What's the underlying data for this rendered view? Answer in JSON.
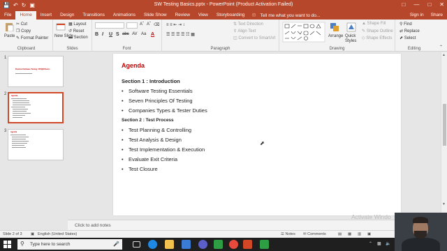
{
  "window": {
    "title": "SW Testing Basics.pptx - PowerPoint (Product Activation Failed)",
    "accent": "#b7472a"
  },
  "ribbon_tabs": [
    "File",
    "Home",
    "Insert",
    "Design",
    "Transitions",
    "Animations",
    "Slide Show",
    "Review",
    "View",
    "Storyboarding"
  ],
  "active_tab": "Home",
  "tell_me": "Tell me what you want to do...",
  "account": {
    "sign_in": "Sign in",
    "share": "Share"
  },
  "clipboard": {
    "paste": "Paste",
    "cut": "Cut",
    "copy": "Copy",
    "format_painter": "Format Painter",
    "label": "Clipboard"
  },
  "slides_group": {
    "new_slide": "New Slide",
    "layout": "Layout",
    "reset": "Reset",
    "section": "Section",
    "label": "Slides"
  },
  "font_group": {
    "label": "Font",
    "buttons": [
      "B",
      "I",
      "U",
      "S",
      "abc",
      "AV",
      "Aa",
      "A"
    ]
  },
  "paragraph_group": {
    "text_direction": "Text Direction",
    "align_text": "Align Text",
    "convert_smartart": "Convert to SmartArt",
    "label": "Paragraph"
  },
  "drawing_group": {
    "arrange": "Arrange",
    "quick_styles": "Quick Styles",
    "shape_fill": "Shape Fill",
    "shape_outline": "Shape Outline",
    "shape_effects": "Shape Effects",
    "label": "Drawing"
  },
  "editing_group": {
    "find": "Find",
    "replace": "Replace",
    "select": "Select",
    "label": "Editing"
  },
  "thumbnails": [
    {
      "number": "1",
      "title": "Practical Software Testing / ISTQB Basics"
    },
    {
      "number": "2",
      "title": "Agenda"
    },
    {
      "number": "3",
      "title": "Agenda"
    }
  ],
  "slide": {
    "heading": "Agenda",
    "section1": "Section 1 : Introduction",
    "section1_items": [
      "Software Testing Essentials",
      "Seven Principles Of Testing",
      "Companies Types & Tester Duties"
    ],
    "section2": "Section 2 : Test Process",
    "section2_items": [
      "Test Planning & Controlling",
      "Test Analysis & Design",
      "Test Implementation & Execution",
      "Evaluate Exit Criteria",
      "Test Closure"
    ]
  },
  "notes_placeholder": "Click to add notes",
  "status": {
    "slide_pos": "Slide 2 of 3",
    "language": "English (United States)",
    "notes": "Notes",
    "comments": "Comments"
  },
  "watermark": "Activate Windo",
  "taskbar": {
    "search_placeholder": "Type here to search"
  }
}
